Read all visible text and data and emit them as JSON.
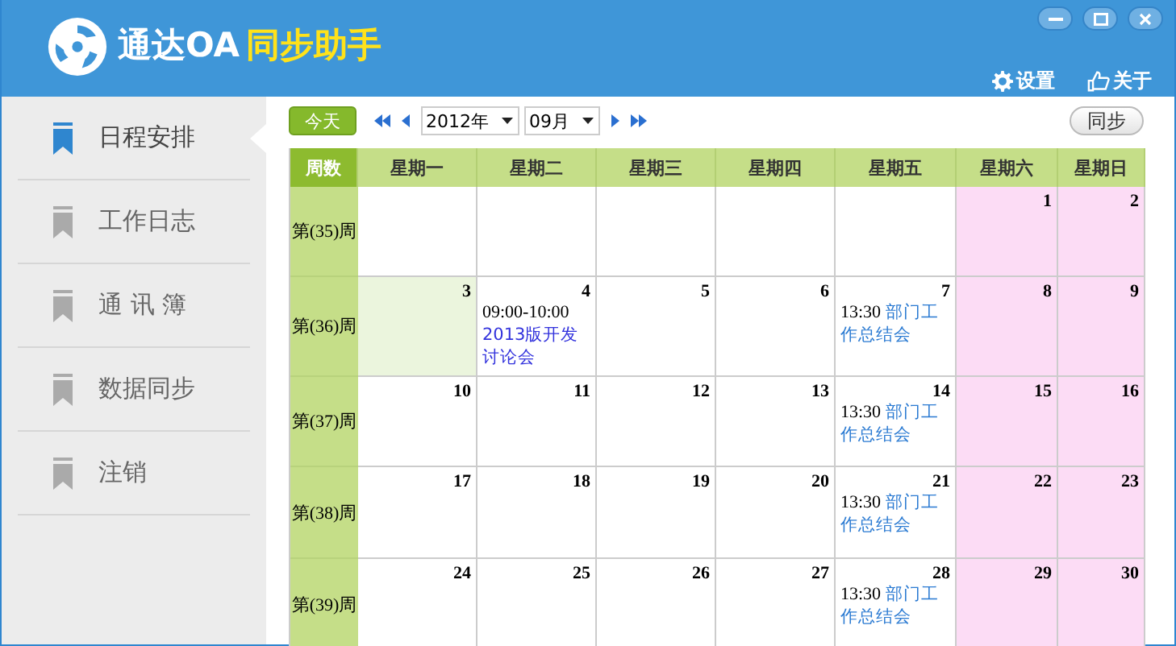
{
  "header": {
    "title_main": "通达OA",
    "title_accent": "同步助手",
    "links": [
      {
        "kind": "settings",
        "label": "设置"
      },
      {
        "kind": "about",
        "label": "关于"
      }
    ]
  },
  "sidebar": {
    "items": [
      {
        "label": "日程安排",
        "selected": true
      },
      {
        "label": "工作日志",
        "selected": false
      },
      {
        "label": "通 讯 簿",
        "selected": false
      },
      {
        "label": "数据同步",
        "selected": false
      },
      {
        "label": "注销",
        "selected": false
      }
    ]
  },
  "toolbar": {
    "today_button": "今天",
    "year": "2012年",
    "month": "09月",
    "sync_button": "同步"
  },
  "calendar": {
    "week_header": "周数",
    "columns": [
      "星期一",
      "星期二",
      "星期三",
      "星期四",
      "星期五",
      "星期六",
      "星期日"
    ],
    "weeks": [
      {
        "label": "第(35)周",
        "cells": [
          {
            "kind": "empty",
            "weekend": false
          },
          {
            "kind": "empty",
            "weekend": false
          },
          {
            "kind": "empty",
            "weekend": false
          },
          {
            "kind": "empty",
            "weekend": false
          },
          {
            "kind": "empty",
            "weekend": false
          },
          {
            "kind": "day",
            "day": "1",
            "today": false,
            "weekend": true
          },
          {
            "kind": "day",
            "day": "2",
            "today": false,
            "weekend": true
          }
        ]
      },
      {
        "label": "第(36)周",
        "cells": [
          {
            "kind": "day",
            "day": "3",
            "today": true,
            "weekend": false
          },
          {
            "kind": "day",
            "day": "4",
            "today": false,
            "weekend": false,
            "events": [
              {
                "time": "09:00-10:00",
                "title": "2013版开发讨论会",
                "color": "#3333dd"
              }
            ]
          },
          {
            "kind": "day",
            "day": "5",
            "today": false,
            "weekend": false
          },
          {
            "kind": "day",
            "day": "6",
            "today": false,
            "weekend": false
          },
          {
            "kind": "day",
            "day": "7",
            "today": false,
            "weekend": false,
            "events": [
              {
                "time": "13:30",
                "title": "部门工作总结会",
                "color": "#2a7ad2"
              }
            ]
          },
          {
            "kind": "day",
            "day": "8",
            "today": false,
            "weekend": true
          },
          {
            "kind": "day",
            "day": "9",
            "today": false,
            "weekend": true
          }
        ]
      },
      {
        "label": "第(37)周",
        "cells": [
          {
            "kind": "day",
            "day": "10",
            "today": false,
            "weekend": false
          },
          {
            "kind": "day",
            "day": "11",
            "today": false,
            "weekend": false
          },
          {
            "kind": "day",
            "day": "12",
            "today": false,
            "weekend": false
          },
          {
            "kind": "day",
            "day": "13",
            "today": false,
            "weekend": false
          },
          {
            "kind": "day",
            "day": "14",
            "today": false,
            "weekend": false,
            "events": [
              {
                "time": "13:30",
                "title": "部门工作总结会",
                "color": "#2a7ad2"
              }
            ]
          },
          {
            "kind": "day",
            "day": "15",
            "today": false,
            "weekend": true
          },
          {
            "kind": "day",
            "day": "16",
            "today": false,
            "weekend": true
          }
        ]
      },
      {
        "label": "第(38)周",
        "cells": [
          {
            "kind": "day",
            "day": "17",
            "today": false,
            "weekend": false
          },
          {
            "kind": "day",
            "day": "18",
            "today": false,
            "weekend": false
          },
          {
            "kind": "day",
            "day": "19",
            "today": false,
            "weekend": false
          },
          {
            "kind": "day",
            "day": "20",
            "today": false,
            "weekend": false
          },
          {
            "kind": "day",
            "day": "21",
            "today": false,
            "weekend": false,
            "events": [
              {
                "time": "13:30",
                "title": "部门工作总结会",
                "color": "#2a7ad2"
              }
            ]
          },
          {
            "kind": "day",
            "day": "22",
            "today": false,
            "weekend": true
          },
          {
            "kind": "day",
            "day": "23",
            "today": false,
            "weekend": true
          }
        ]
      },
      {
        "label": "第(39)周",
        "cells": [
          {
            "kind": "day",
            "day": "24",
            "today": false,
            "weekend": false
          },
          {
            "kind": "day",
            "day": "25",
            "today": false,
            "weekend": false
          },
          {
            "kind": "day",
            "day": "26",
            "today": false,
            "weekend": false
          },
          {
            "kind": "day",
            "day": "27",
            "today": false,
            "weekend": false
          },
          {
            "kind": "day",
            "day": "28",
            "today": false,
            "weekend": false,
            "events": [
              {
                "time": "13:30",
                "title": "部门工作总结会",
                "color": "#2a7ad2"
              }
            ]
          },
          {
            "kind": "day",
            "day": "29",
            "today": false,
            "weekend": true
          },
          {
            "kind": "day",
            "day": "30",
            "today": false,
            "weekend": true
          }
        ]
      }
    ]
  }
}
